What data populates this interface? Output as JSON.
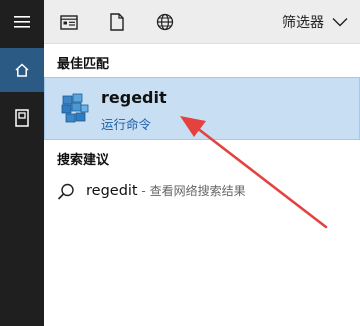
{
  "toolbar": {
    "filter_label": "筛选器",
    "icons": [
      "apps-icon",
      "document-icon",
      "web-globe-icon",
      "chevron-down-icon"
    ]
  },
  "rail": {
    "icons": [
      "hamburger-menu-icon",
      "home-icon",
      "documents-icon"
    ]
  },
  "best_match": {
    "section_label": "最佳匹配",
    "app_name": "regedit",
    "app_type": "运行命令",
    "icon": "registry-editor-icon"
  },
  "suggestions": {
    "section_label": "搜索建议",
    "items": [
      {
        "term": "regedit",
        "hint": " - 查看网络搜索结果",
        "icon": "search-icon"
      }
    ]
  },
  "colors": {
    "rail_bg": "#1f1f1f",
    "rail_active": "#2b5b84",
    "highlight_bg": "#c8def2",
    "link_blue": "#2161a6",
    "annotation_red": "#e5413f"
  }
}
